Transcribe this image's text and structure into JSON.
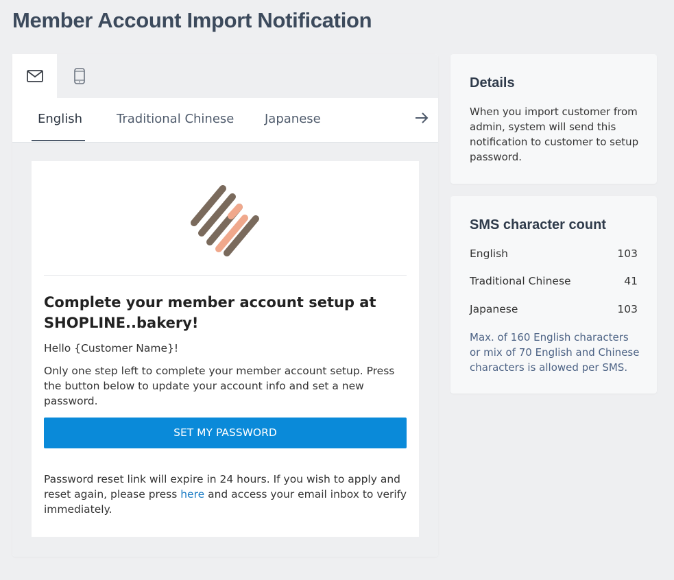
{
  "page": {
    "title": "Member Account Import Notification"
  },
  "channels": [
    {
      "name": "email",
      "icon": "envelope-icon",
      "active": true
    },
    {
      "name": "sms",
      "icon": "mobile-phone-icon",
      "active": false
    }
  ],
  "language_tabs": [
    {
      "label": "English",
      "active": true
    },
    {
      "label": "Traditional Chinese",
      "active": false
    },
    {
      "label": "Japanese",
      "active": false
    }
  ],
  "email": {
    "logo_colors": {
      "dark": "#7a6a5c",
      "light": "#f0a88c"
    },
    "heading": "Complete your member account setup at SHOPLINE..bakery!",
    "greeting": "Hello {Customer Name}!",
    "body": "Only one step left to complete your member account setup. Press the button below to update your account info and set a new password.",
    "button_label": "SET MY PASSWORD",
    "button_color": "#0a8ad9",
    "footer_before_link": "Password reset link will expire in 24 hours. If you wish to apply and reset again, please press ",
    "footer_link": "here",
    "footer_after_link": " and access your email inbox to verify immediately."
  },
  "details": {
    "title": "Details",
    "text": "When you import customer from admin, system will send this notification to customer to setup password."
  },
  "sms_count": {
    "title": "SMS character count",
    "rows": [
      {
        "language": "English",
        "count": "103"
      },
      {
        "language": "Traditional Chinese",
        "count": "41"
      },
      {
        "language": "Japanese",
        "count": "103"
      }
    ],
    "note": "Max. of 160 English characters or mix of 70 English and Chinese characters is allowed per SMS."
  }
}
